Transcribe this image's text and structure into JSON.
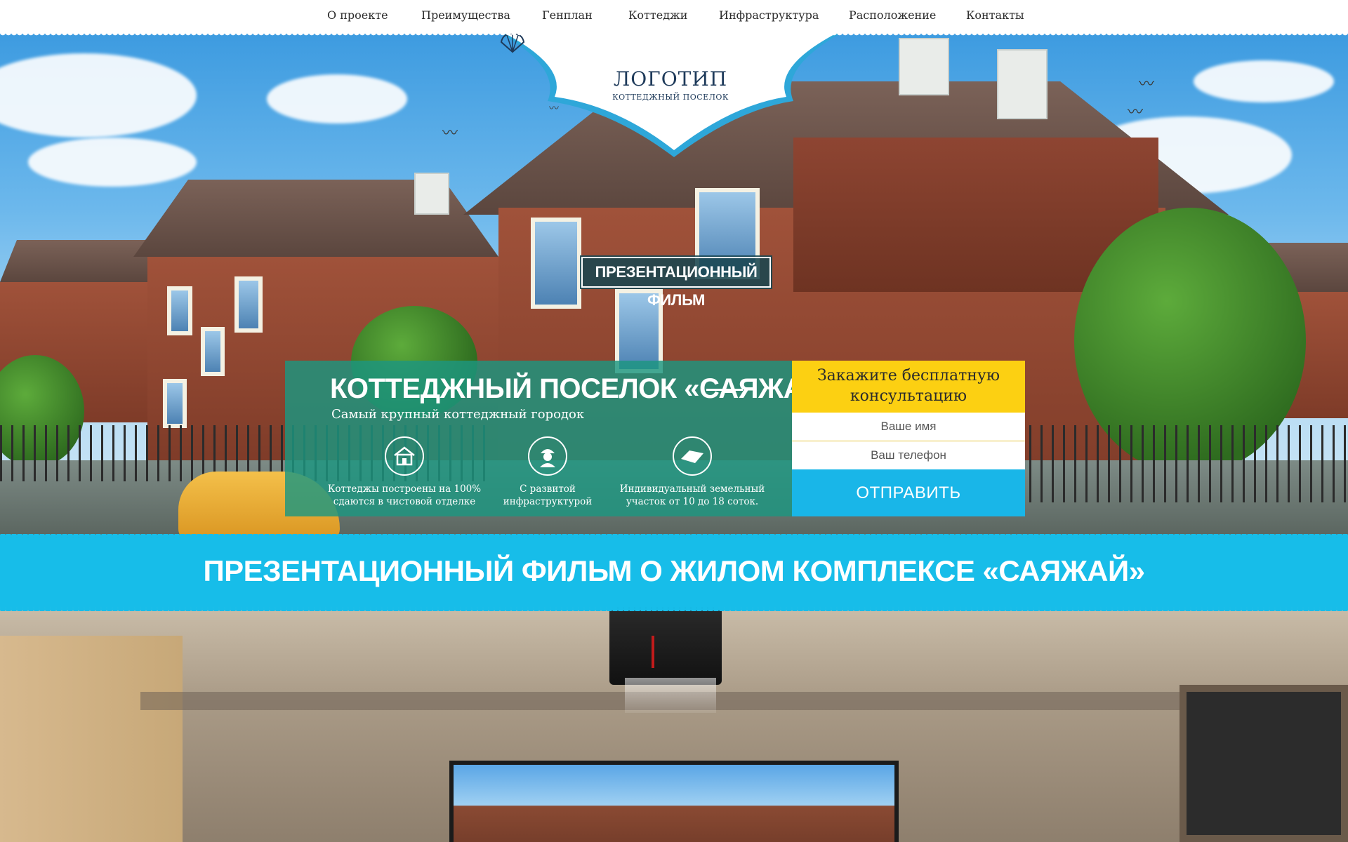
{
  "nav": {
    "items": [
      "О проекте",
      "Преимущества",
      "Генплан",
      "Коттеджи",
      "Инфраструктура",
      "Расположение",
      "Контакты"
    ]
  },
  "logo": {
    "title": "ЛОГОТИП",
    "subtitle": "КОТТЕДЖНЫЙ ПОСЕЛОК"
  },
  "hero": {
    "film_button": "ПРЕЗЕНТАЦИОННЫЙ ФИЛЬМ",
    "title": "КОТТЕДЖНЫЙ ПОСЕЛОК «САЯЖАЙ»",
    "subtitle": "Самый крупный коттеджный городок",
    "features": [
      {
        "icon": "house-icon",
        "text_line1": "Коттеджы построены на 100%",
        "text_line2": "сдаются в чистовой отделке"
      },
      {
        "icon": "worker-icon",
        "text_line1": "С развитой",
        "text_line2": "инфраструктурой"
      },
      {
        "icon": "land-plot-icon",
        "text_line1": "Индивидуальный земельный",
        "text_line2": "участок от 10 до 18 соток."
      }
    ]
  },
  "form": {
    "heading_line1": "Закажите бесплатную",
    "heading_line2": "консультацию",
    "name_placeholder": "Ваше имя",
    "phone_placeholder": "Ваш телефон",
    "submit_label": "ОТПРАВИТЬ"
  },
  "film_section": {
    "title": "ПРЕЗЕНТАЦИОННЫЙ ФИЛЬМ О ЖИЛОМ КОМПЛЕКСЕ «САЯЖАЙ»"
  },
  "colors": {
    "teal_panel": "#1c9680",
    "form_header": "#fcd012",
    "accent_blue": "#19b6e8",
    "logo_text": "#1e3a5a"
  }
}
